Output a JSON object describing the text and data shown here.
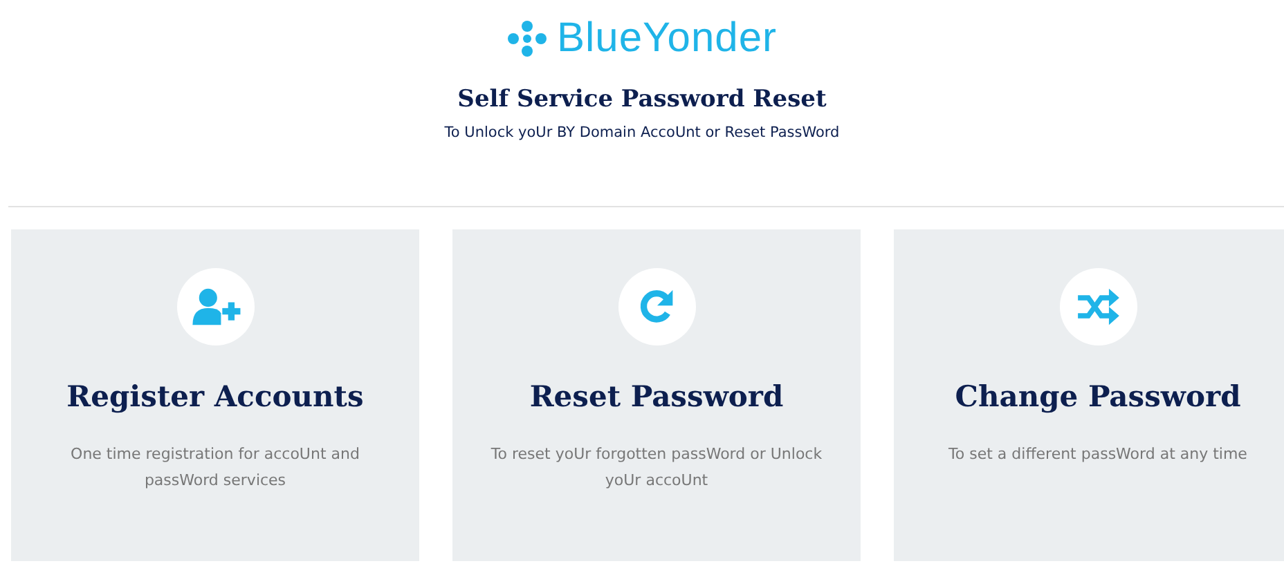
{
  "header": {
    "logo_text": "BlueYonder",
    "title": "Self Service Password Reset",
    "subtitle": "To Unlock yoUr BY Domain AccoUnt or Reset PassWord"
  },
  "cards": [
    {
      "kind": "register",
      "title": "Register Accounts",
      "description": "One time registration for accoUnt and passWord services"
    },
    {
      "kind": "reset",
      "title": "Reset Password",
      "description": "To reset yoUr forgotten passWord or Unlock yoUr accoUnt"
    },
    {
      "kind": "change",
      "title": "Change Password",
      "description": "To set a different passWord at any time"
    }
  ]
}
